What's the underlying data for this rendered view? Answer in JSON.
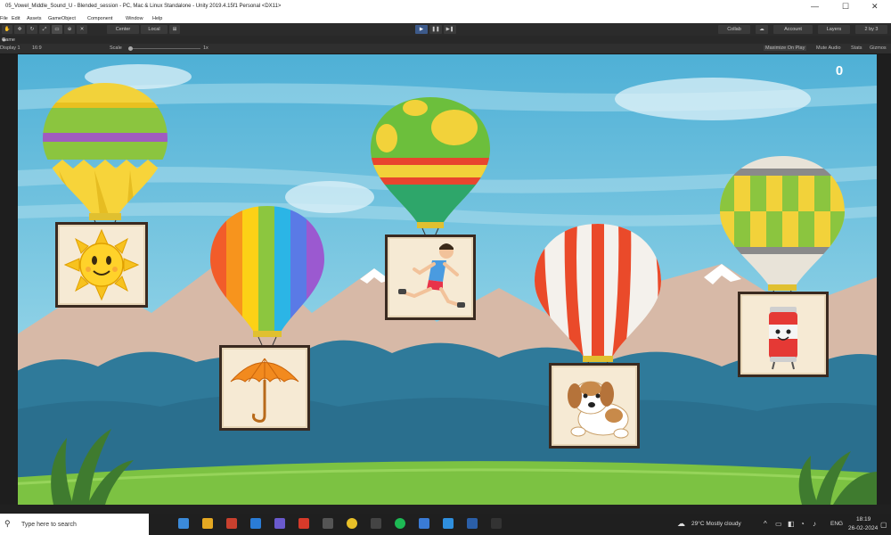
{
  "window": {
    "title": "05_Vowel_Middle_Sound_U - Blended_session - PC, Mac & Linux Standalone - Unity 2019.4.15f1 Personal <DX11>"
  },
  "menu": [
    "File",
    "Edit",
    "Assets",
    "GameObject",
    "Component",
    "Window",
    "Help"
  ],
  "toolbar": {
    "pivot_label": "Center",
    "space_label": "Local",
    "collab_label": "Collab",
    "account_label": "Account",
    "layers_label": "Layers",
    "layout_label": "2 by 3"
  },
  "tabs": {
    "game_tab_label": "Game"
  },
  "gamebar": {
    "display_label": "Display 1",
    "aspect_label": "16:9",
    "scale_label": "Scale",
    "scale_value": "1x",
    "maximize_label": "Maximize On Play",
    "mute_label": "Mute Audio",
    "stats_label": "Stats",
    "gizmos_label": "Gizmos"
  },
  "game": {
    "score": "0",
    "cards": [
      {
        "name": "sun",
        "icon": "sun-icon"
      },
      {
        "name": "umbrella",
        "icon": "umbrella-icon"
      },
      {
        "name": "running boy",
        "icon": "runner-icon"
      },
      {
        "name": "puppy",
        "icon": "puppy-icon"
      },
      {
        "name": "soda can",
        "icon": "can-icon"
      }
    ],
    "colors": {
      "sky_top": "#5cb8d8",
      "sky_bottom": "#9fd7e8",
      "mountains": "#d7b9a7",
      "hills": "#2f7a9a",
      "grass": "#7cc242"
    }
  },
  "taskbar": {
    "search_placeholder": "Type here to search",
    "weather": "29°C  Mostly cloudy",
    "language": "ENG",
    "time": "18:19",
    "date": "26-02-2024"
  }
}
